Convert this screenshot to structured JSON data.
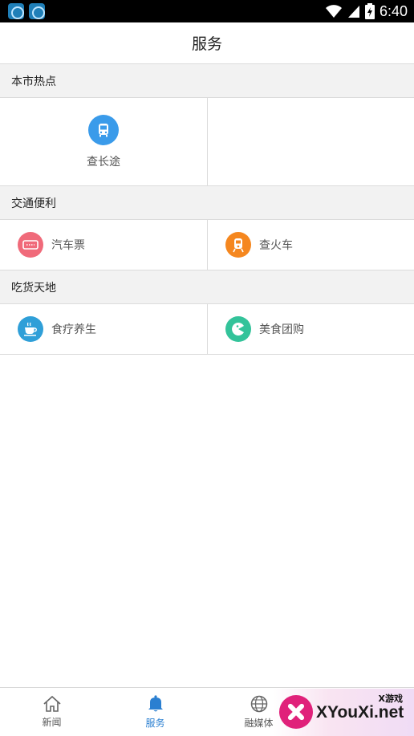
{
  "status_bar": {
    "time": "6:40",
    "icons": [
      "app-icon",
      "app-icon",
      "wifi-icon",
      "signal-icon",
      "battery-icon"
    ]
  },
  "header": {
    "title": "服务"
  },
  "sections": [
    {
      "title": "本市热点",
      "items": [
        {
          "label": "查长途",
          "icon": "bus-icon",
          "color": "#3a9bea"
        }
      ]
    },
    {
      "title": "交通便利",
      "items": [
        {
          "label": "汽车票",
          "icon": "ticket-icon",
          "color": "#f06a7a"
        },
        {
          "label": "查火车",
          "icon": "train-icon",
          "color": "#f5871f"
        }
      ]
    },
    {
      "title": "吃货天地",
      "items": [
        {
          "label": "食疗养生",
          "icon": "cup-icon",
          "color": "#2f9fd8"
        },
        {
          "label": "美食团购",
          "icon": "pacman-icon",
          "color": "#33c39a"
        }
      ]
    }
  ],
  "tabbar": {
    "accent": "#2a7fd1",
    "tabs": [
      {
        "label": "新闻",
        "icon": "home-icon",
        "active": false
      },
      {
        "label": "服务",
        "icon": "bell-icon",
        "active": true
      },
      {
        "label": "融媒体",
        "icon": "globe-icon",
        "active": false
      }
    ]
  },
  "watermark": {
    "small": "X游戏",
    "main": "XYouXi.net"
  }
}
